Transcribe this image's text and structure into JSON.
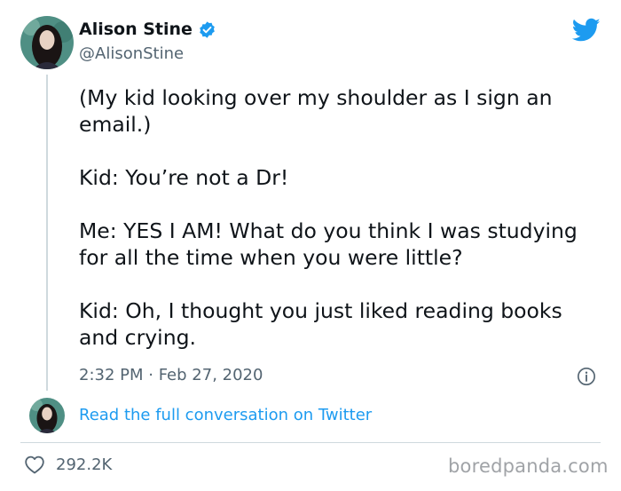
{
  "user": {
    "name": "Alison Stine",
    "handle": "@AlisonStine"
  },
  "tweet": {
    "paragraphs": [
      "(My kid looking over my shoulder as I sign an email.)",
      "Kid: You’re not a Dr!",
      "Me: YES I AM! What do you think I was studying for all the time when you were little?",
      "Kid: Oh, I thought you just liked reading books and crying."
    ],
    "timestamp": "2:32 PM · Feb 27, 2020"
  },
  "actions": {
    "read_link": "Read the full conversation on Twitter",
    "likes": "292.2K"
  },
  "watermark": "boredpanda.com",
  "colors": {
    "accent": "#1d9bf0",
    "text": "#0f1419",
    "secondary": "#536471",
    "divider": "#cfd9de"
  },
  "icons": [
    "verified-badge-icon",
    "twitter-bird-icon",
    "info-icon",
    "heart-icon"
  ]
}
